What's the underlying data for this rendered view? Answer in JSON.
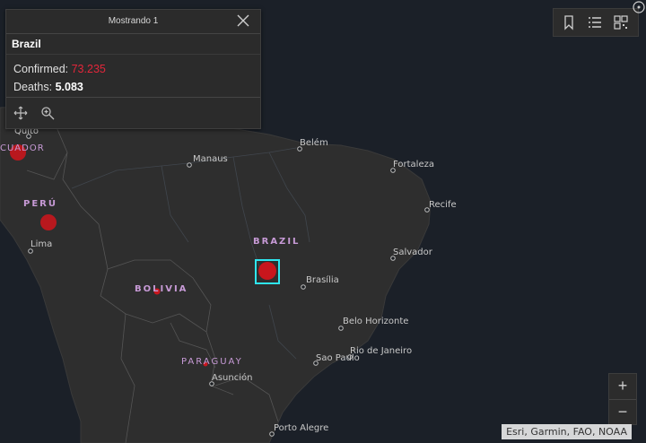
{
  "popup": {
    "header": "Mostrando 1",
    "title": "Brazil",
    "confirmed_label": "Confirmed: ",
    "confirmed_value": "73.235",
    "deaths_label": "Deaths: ",
    "deaths_value": "5.083",
    "icons": [
      "pan-icon",
      "zoom-to-icon",
      "close-icon"
    ]
  },
  "toolbar": {
    "icons": [
      "bookmark-icon",
      "legend-list-icon",
      "qr-basemap-icon"
    ]
  },
  "zoom": {
    "in_label": "+",
    "out_label": "−"
  },
  "attribution": "Esri, Garmin, FAO, NOAA",
  "colors": {
    "case_marker": "#c8161d",
    "highlight": "#2ee6f0",
    "country_label": "#c79ad6",
    "confirmed": "#e3263a"
  },
  "map": {
    "countries": {
      "brazil": "BRAZIL",
      "peru": "PERÚ",
      "bolivia": "BOLIVIA",
      "paraguay": "PARAGUAY",
      "ecuador": "CUADOR"
    },
    "cities": {
      "quito": "Quito",
      "manaus": "Manaus",
      "belem": "Belém",
      "fortaleza": "Fortaleza",
      "recife": "Recife",
      "salvador": "Salvador",
      "brasilia": "Brasília",
      "belo_horizonte": "Belo Horizonte",
      "rio": "Rio de Janeiro",
      "sao_paulo": "Sao Paulo",
      "asuncion": "Asunción",
      "lima": "Lima",
      "porto_alegre": "Porto Alegre"
    }
  }
}
